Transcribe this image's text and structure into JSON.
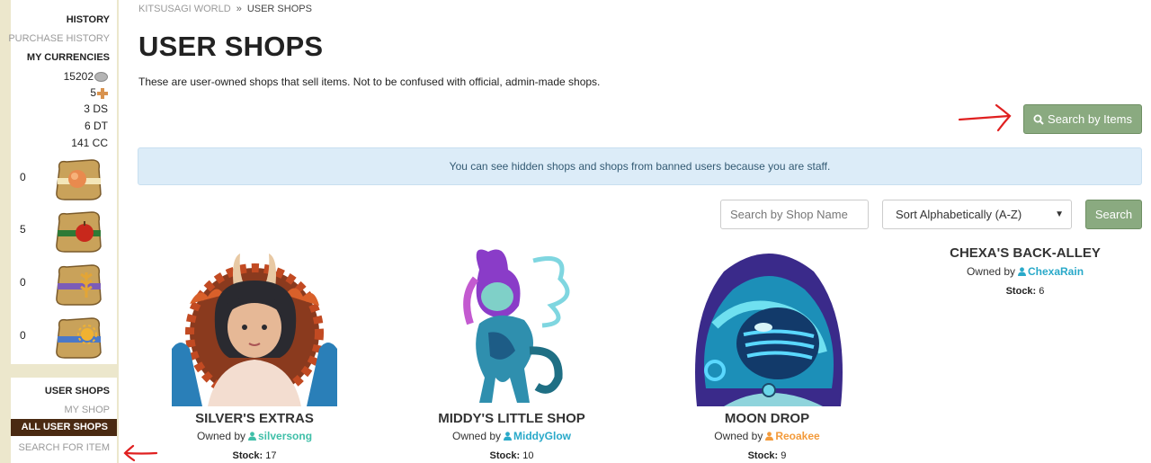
{
  "sidebar": {
    "history_heading": "HISTORY",
    "purchase_history": "PURCHASE HISTORY",
    "currencies_heading": "MY CURRENCIES",
    "currencies": [
      {
        "amount": "15202",
        "unit": "",
        "icon": "silver-coin-icon"
      },
      {
        "amount": "5",
        "unit": "",
        "icon": "orange-cross-icon"
      },
      {
        "amount": "3",
        "unit": "DS",
        "icon": ""
      },
      {
        "amount": "6",
        "unit": "DT",
        "icon": ""
      },
      {
        "amount": "141",
        "unit": "CC",
        "icon": ""
      }
    ],
    "sacks": [
      {
        "count": "0",
        "icon": "peach-sack-icon",
        "color": "#e98a4e"
      },
      {
        "count": "5",
        "icon": "apple-sack-icon",
        "color": "#c8281c"
      },
      {
        "count": "0",
        "icon": "wheat-sack-icon",
        "color": "#e3a536"
      },
      {
        "count": "0",
        "icon": "sun-sack-icon",
        "color": "#f0b232"
      }
    ],
    "shops_heading": "USER SHOPS",
    "my_shop": "MY SHOP",
    "all_user_shops": "ALL USER SHOPS",
    "search_for_item": "SEARCH FOR ITEM"
  },
  "breadcrumb": {
    "root": "KITSUSAGI WORLD",
    "separator": "»",
    "current": "USER SHOPS"
  },
  "page": {
    "title": "USER SHOPS",
    "intro": "These are user-owned shops that sell items. Not to be confused with official, admin-made shops."
  },
  "actions": {
    "search_by_items": "Search by Items"
  },
  "alert": {
    "text": "You can see hidden shops and shops from banned users because you are staff."
  },
  "filters": {
    "shop_name_placeholder": "Search by Shop Name",
    "sort_value": "Sort Alphabetically (A-Z)",
    "search_label": "Search"
  },
  "owned_by_label": "Owned by",
  "stock_label": "Stock:",
  "shops": [
    {
      "name": "SILVER'S EXTRAS",
      "owner": "silversong",
      "owner_color": "#3fbfa8",
      "stock": "17"
    },
    {
      "name": "MIDDY'S LITTLE SHOP",
      "owner": "MiddyGlow",
      "owner_color": "#29a9c9",
      "stock": "10"
    },
    {
      "name": "MOON DROP",
      "owner": "Reoakee",
      "owner_color": "#f39a3a",
      "stock": "9"
    },
    {
      "name": "CHEXA'S BACK-ALLEY",
      "owner": "ChexaRain",
      "owner_color": "#29a9c9",
      "stock": "6"
    }
  ],
  "colors": {
    "button_green": "#8aaa80",
    "sidebar_bg": "#ece7cc",
    "active_nav": "#4a2a12",
    "alert_bg": "#dcecf8",
    "annotation_red": "#e02020"
  }
}
